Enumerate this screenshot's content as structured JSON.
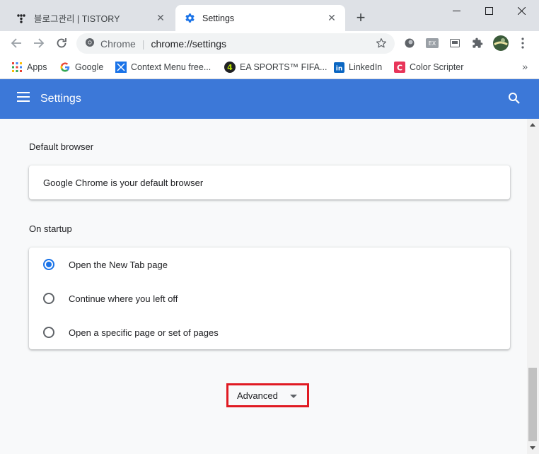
{
  "tabs": [
    {
      "title": "블로그관리 | TISTORY",
      "icon": "tistory-icon"
    },
    {
      "title": "Settings",
      "icon": "gear-icon"
    }
  ],
  "omnibox": {
    "chip": "Chrome",
    "url": "chrome://settings"
  },
  "bookmarks": [
    {
      "label": "Apps",
      "icon": "apps-grid-icon"
    },
    {
      "label": "Google",
      "icon": "google-icon"
    },
    {
      "label": "Context Menu free...",
      "icon": "context-menu-icon"
    },
    {
      "label": "EA SPORTS™ FIFA...",
      "icon": "fifa-icon"
    },
    {
      "label": "LinkedIn",
      "icon": "linkedin-icon"
    },
    {
      "label": "Color Scripter",
      "icon": "color-scripter-icon"
    }
  ],
  "header": {
    "title": "Settings"
  },
  "default_browser": {
    "section_title": "Default browser",
    "status": "Google Chrome is your default browser"
  },
  "on_startup": {
    "section_title": "On startup",
    "options": [
      {
        "label": "Open the New Tab page",
        "checked": true
      },
      {
        "label": "Continue where you left off",
        "checked": false
      },
      {
        "label": "Open a specific page or set of pages",
        "checked": false
      }
    ]
  },
  "advanced": {
    "label": "Advanced"
  },
  "colors": {
    "header_blue": "#3c78d8",
    "accent": "#1a73e8",
    "highlight_box": "#e01a22"
  }
}
